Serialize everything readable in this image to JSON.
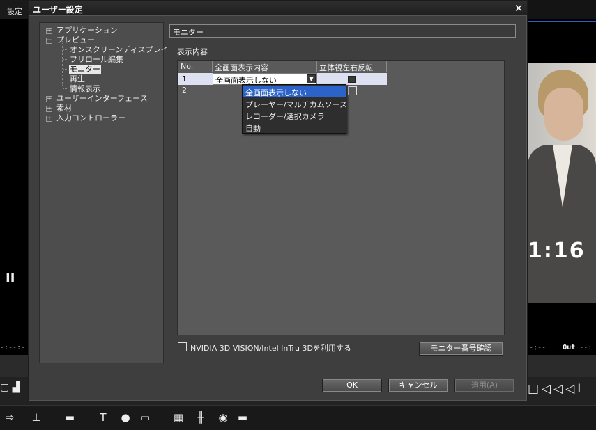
{
  "background": {
    "menu_label": "設定",
    "left_tc": "-:--:-",
    "right_tc": "-;--",
    "right_out_label": "Out",
    "right_out_tc": "--:",
    "clock": "1:16",
    "pause_glyph": "II",
    "transport_glyphs": "□◁◁◁I",
    "toolbar_icons": [
      "trim-icon",
      "marker-icon",
      "range-icon",
      "title-icon",
      "microphone-icon",
      "export-icon",
      "grid-icon",
      "mixer-icon",
      "color-icon",
      "layout-icon"
    ]
  },
  "dialog": {
    "title": "ユーザー設定",
    "close_glyph": "✕",
    "tree": [
      {
        "label": "アプリケーション",
        "expander": "+"
      },
      {
        "label": "プレビュー",
        "expander": "−"
      },
      {
        "label": "オンスクリーンディスプレイ"
      },
      {
        "label": "プリロール編集"
      },
      {
        "label": "モニター",
        "selected": true
      },
      {
        "label": "再生"
      },
      {
        "label": "情報表示"
      },
      {
        "label": "ユーザーインターフェース",
        "expander": "+"
      },
      {
        "label": "素材",
        "expander": "+"
      },
      {
        "label": "入力コントローラー",
        "expander": "+"
      }
    ],
    "panel_title": "モニター",
    "section_label": "表示内容",
    "table": {
      "headers": [
        "No.",
        "全画面表示内容",
        "立体視左右反転"
      ],
      "rows": [
        {
          "no": "1",
          "content": "全画面表示しない",
          "stereo_flip": true
        },
        {
          "no": "2",
          "content": "",
          "stereo_flip": false
        }
      ]
    },
    "dropdown_options": [
      "全画面表示しない",
      "プレーヤー/マルチカムソース",
      "レコーダー/選択カメラ",
      "自動"
    ],
    "dropdown_selected": "全画面表示しない",
    "nvidia_label": "NVIDIA 3D VISION/Intel InTru 3Dを利用する",
    "nvidia_checked": false,
    "monitor_check_button": "モニター番号確認",
    "ok_button": "OK",
    "cancel_button": "キャンセル",
    "apply_button": "適用(A)",
    "apply_enabled": false
  }
}
